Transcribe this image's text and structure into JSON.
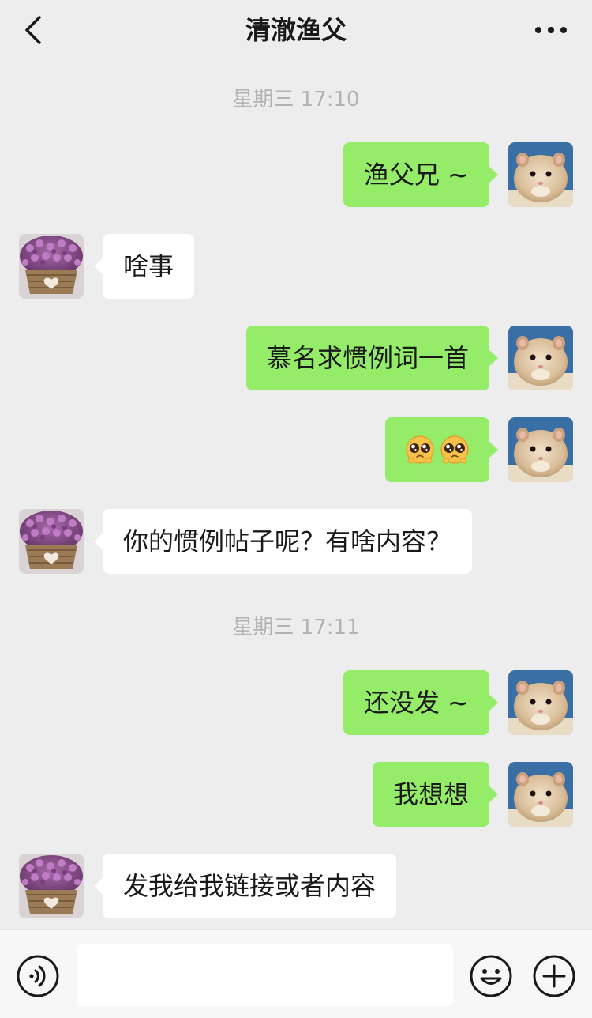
{
  "header": {
    "title": "清澈渔父",
    "back_icon": "chevron-left-icon",
    "more_icon": "more-dots-icon"
  },
  "timestamps": [
    "星期三 17:10",
    "星期三 17:11"
  ],
  "messages": [
    {
      "sender": "me",
      "text": "渔父兄 ~"
    },
    {
      "sender": "them",
      "text": "啥事"
    },
    {
      "sender": "me",
      "text": "慕名求惯例词一首"
    },
    {
      "sender": "me",
      "text": "",
      "emoji": "pleading-face-emoji x2"
    },
    {
      "sender": "them",
      "text": "你的惯例帖子呢？有啥内容？"
    },
    {
      "sender": "me",
      "text": "还没发 ~"
    },
    {
      "sender": "me",
      "text": "我想想"
    },
    {
      "sender": "them",
      "text": "发我给我链接或者内容"
    }
  ],
  "input_bar": {
    "voice_icon": "voice-icon",
    "input_value": "",
    "emoji_icon": "emoji-icon",
    "plus_icon": "plus-icon"
  },
  "colors": {
    "background": "#ededed",
    "my_bubble": "#95ec69",
    "their_bubble": "#ffffff",
    "timestamp_text": "#b3b3b3"
  }
}
